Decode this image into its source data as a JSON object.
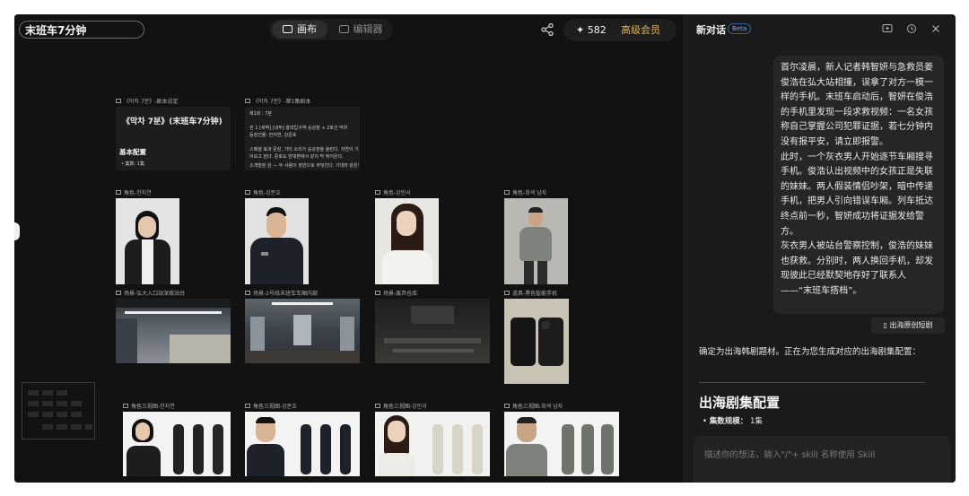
{
  "header": {
    "project_title": "末班车7分钟",
    "modes": [
      {
        "label": "画布",
        "active": true
      },
      {
        "label": "编辑器",
        "active": false
      }
    ],
    "credits": "582",
    "membership": "高级会员"
  },
  "canvas": {
    "docs": [
      {
        "label": "《막차 7분》-剧本设定",
        "heading": "《막차 7분》(末班车7分钟)",
        "subheading": "基本配置",
        "line": "• 集数: 1集"
      },
      {
        "label": "《막차 7분》-第1集剧本",
        "lines": [
          "제1화 : 7분",
          "씬 1 [새벽] [내부] 홍대입구역 승강장 + 2호선 막차",
          "등장인물: 한지연, 강준호",
          "스페셜 효과 문장, 기타 소리가 승강장을 울린다. 지연이 기댄을 열",
          "어보고 뛴다. 준호도 반대편에서 같이 막 뛰어온다.",
          "소개발된 원 — 두 사람이 정반으로 부딪친다. 기대와 같은색 핸드"
        ]
      }
    ],
    "character_labels": [
      "角色-한지연",
      "角色-강준호",
      "角色-강민서",
      "角色-회색 남자"
    ],
    "scene_labels": [
      "场景-弘大入口站深夜站台",
      "场景-2号线末班车车厢内部",
      "场景-废弃仓库",
      "道具-黑色智能手机"
    ],
    "three_view_labels": [
      "角色三视图-한지연",
      "角色三视图-강준호",
      "角色三视图-강민서",
      "角色三视图-회색 남자"
    ]
  },
  "chat": {
    "title": "新对话",
    "badge": "Beta",
    "user_message": [
      "首尔凌晨，新人记者韩智妍与急救员姜俊浩在弘大站相撞，误拿了对方一模一样的手机。末班车启动后，智妍在俊浩的手机里发现一段求救视频：一名女孩称自己掌握公司犯罪证据，若七分钟内没有报平安，请立即报警。",
      "此时，一个灰衣男人开始逐节车厢搜寻手机。俊浩认出视频中的女孩正是失联的妹妹。两人假装情侣吵架，暗中传递手机，把男人引向错误车厢。列车抵达终点前一秒，智妍成功将证据发给警方。",
      "灰衣男人被站台警察控制，俊浩的妹妹也获救。分别时，两人换回手机，却发现彼此已经默契地存好了联系人——“末班车搭档”。"
    ],
    "skill_button": "出海原创短剧",
    "reply": "确定为出海韩剧题材。正在为您生成对应的出海剧集配置：",
    "section_heading": "出海剧集配置",
    "bullet_label": "集数规模：",
    "bullet_value": "1集",
    "input_placeholder": "描述你的想法，输入\"/\"+ skill 名称使用 Skill"
  }
}
